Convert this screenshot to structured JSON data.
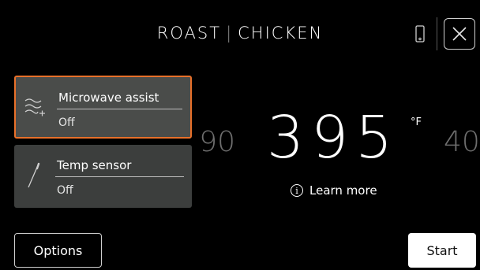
{
  "header": {
    "title_left": "ROAST",
    "title_separator": "|",
    "title_right": "CHICKEN"
  },
  "cards": [
    {
      "title": "Microwave assist",
      "value": "Off",
      "icon": "microwave-waves-plus-icon",
      "selected": true
    },
    {
      "title": "Temp sensor",
      "value": "Off",
      "icon": "temp-probe-icon",
      "selected": false
    }
  ],
  "temperature": {
    "prev_partial": "90",
    "value": "395",
    "unit": "°F",
    "next_partial": "40"
  },
  "learn_more": {
    "label": "Learn more",
    "icon": "info-icon"
  },
  "buttons": {
    "options": "Options",
    "start": "Start"
  },
  "colors": {
    "accent": "#e8702a",
    "background": "#000000",
    "card": "#3c3e3d"
  }
}
